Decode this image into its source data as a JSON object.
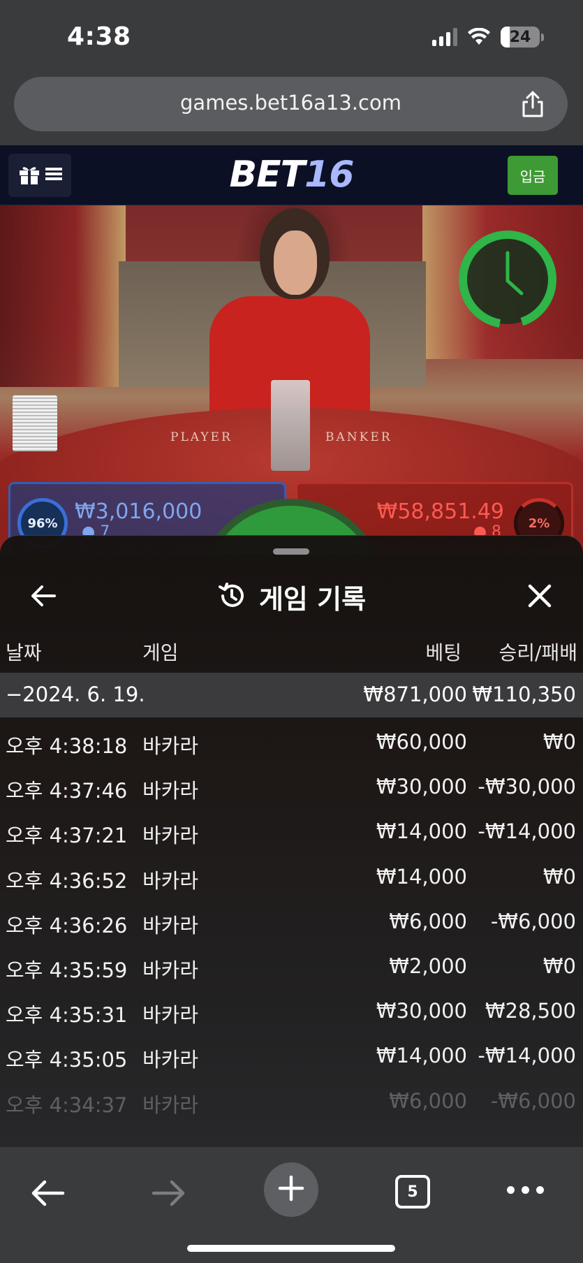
{
  "status_bar": {
    "time": "4:38",
    "battery": "24"
  },
  "browser": {
    "url": "games.bet16a13.com",
    "tabs_count": "5"
  },
  "site": {
    "logo_part1": "BET",
    "logo_part2": "16",
    "deposit_label": "입금"
  },
  "video": {
    "table_player_label": "PLAYER",
    "table_banker_label": "BANKER",
    "player_pct": "96%",
    "player_amount": "₩3,016,000",
    "player_count": "● 7",
    "banker_pct": "2%",
    "banker_amount": "₩58,851.49",
    "banker_count": "● 8"
  },
  "history": {
    "title": "게임 기록",
    "columns": {
      "date": "날짜",
      "game": "게임",
      "bet": "베팅",
      "winloss": "승리/패배"
    },
    "date_group": {
      "date": "−2024. 6. 19.",
      "bet_total": "₩871,000",
      "winloss_total": "₩110,350"
    },
    "rows": [
      {
        "time": "오후 4:38:18",
        "game": "바카라",
        "bet": "₩60,000",
        "winloss": "₩0"
      },
      {
        "time": "오후 4:37:46",
        "game": "바카라",
        "bet": "₩30,000",
        "winloss": "-₩30,000"
      },
      {
        "time": "오후 4:37:21",
        "game": "바카라",
        "bet": "₩14,000",
        "winloss": "-₩14,000"
      },
      {
        "time": "오후 4:36:52",
        "game": "바카라",
        "bet": "₩14,000",
        "winloss": "₩0"
      },
      {
        "time": "오후 4:36:26",
        "game": "바카라",
        "bet": "₩6,000",
        "winloss": "-₩6,000"
      },
      {
        "time": "오후 4:35:59",
        "game": "바카라",
        "bet": "₩2,000",
        "winloss": "₩0"
      },
      {
        "time": "오후 4:35:31",
        "game": "바카라",
        "bet": "₩30,000",
        "winloss": "₩28,500"
      },
      {
        "time": "오후 4:35:05",
        "game": "바카라",
        "bet": "₩14,000",
        "winloss": "-₩14,000"
      },
      {
        "time": "오후 4:34:37",
        "game": "바카라",
        "bet": "₩6,000",
        "winloss": "-₩6,000"
      }
    ]
  },
  "icons": {
    "share": "share-icon",
    "gift": "gift-icon",
    "menu": "hamburger-icon",
    "timer": "clock-icon",
    "back": "arrow-left-icon",
    "history": "history-icon",
    "close": "close-icon",
    "browser_back": "arrow-left-icon",
    "browser_forward": "arrow-right-icon",
    "new_tab": "plus-icon",
    "more": "more-icon"
  },
  "colors": {
    "deposit": "#3d9a34",
    "player": "#2f5fb8",
    "banker": "#b8302a",
    "timer": "#2fb548"
  }
}
